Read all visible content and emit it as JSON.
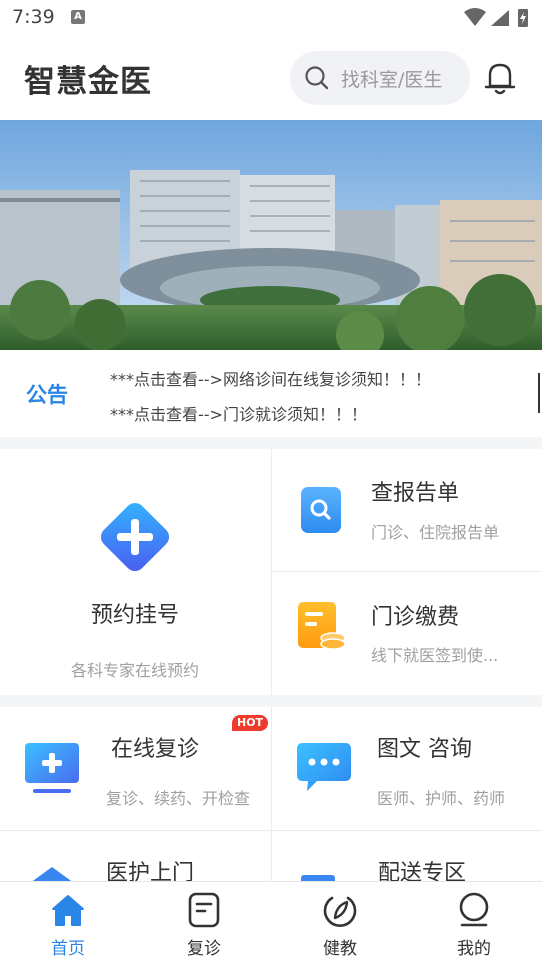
{
  "status_bar": {
    "time": "7:39",
    "notification_letter": "A"
  },
  "header": {
    "title": "智慧金医",
    "search_placeholder": "找科室/医生",
    "search_icon": "search-icon",
    "bell_icon": "bell-icon"
  },
  "notice": {
    "tag": "公告",
    "items": [
      "***点击查看-->网络诊间在线复诊须知！！！",
      "***点击查看-->门诊就诊须知！！！"
    ]
  },
  "services": {
    "appointment": {
      "label": "预约挂号",
      "subtitle": "各科专家在线预约"
    },
    "reports": {
      "label": "查报告单",
      "subtitle": "门诊、住院报告单"
    },
    "payment": {
      "label": "门诊缴费",
      "subtitle": "线下就医签到使..."
    }
  },
  "features": {
    "online_followup": {
      "label": "在线复诊",
      "subtitle": "复诊、续药、开检查",
      "badge": "HOT"
    },
    "consult": {
      "label": "图文 咨询",
      "subtitle": "医师、护师、药师"
    },
    "home_care": {
      "label": "医护上门"
    },
    "delivery": {
      "label": "配送专区"
    }
  },
  "tabbar": {
    "items": [
      {
        "label": "首页",
        "icon": "home-icon",
        "active": true
      },
      {
        "label": "复诊",
        "icon": "document-icon",
        "active": false
      },
      {
        "label": "健教",
        "icon": "leaf-icon",
        "active": false
      },
      {
        "label": "我的",
        "icon": "person-icon",
        "active": false
      }
    ]
  },
  "colors": {
    "accent": "#2a86e6",
    "hot": "#f03a2e",
    "divider": "#f4f5f7"
  }
}
